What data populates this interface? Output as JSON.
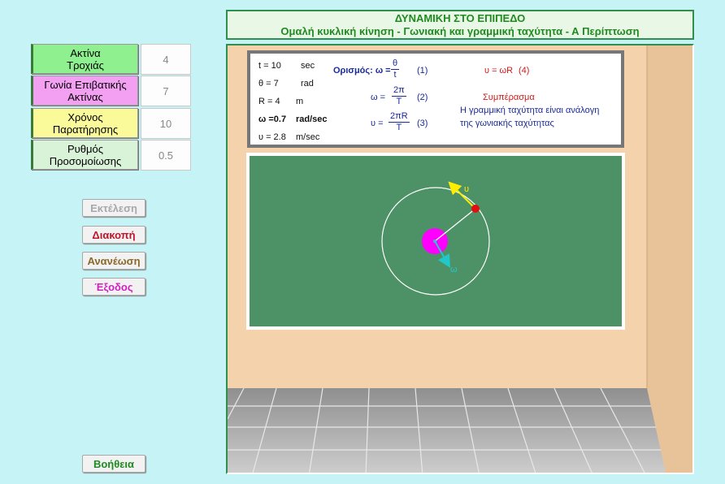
{
  "title": {
    "line1": "ΔΥΝΑΜΙΚΗ ΣΤΟ ΕΠΙΠΕΔΟ",
    "line2": "Ομαλή κυκλική κίνηση  - Γωνιακή και γραμμική ταχύτητα - Α Περίπτωση"
  },
  "params": [
    {
      "label1": "Ακτίνα",
      "label2": "Τροχιάς",
      "value": "4",
      "color": "#8ef08e"
    },
    {
      "label1": "Γωνία Επιβατικής",
      "label2": "Ακτίνας",
      "value": "7",
      "color": "#f3a0f3"
    },
    {
      "label1": "Χρόνος",
      "label2": "Παρατήρησης",
      "value": "10",
      "color": "#fafa9a"
    },
    {
      "label1": "Ρυθμός",
      "label2": "Προσομοίωσης",
      "value": "0.5",
      "color": "#d9f3d9"
    }
  ],
  "buttons": {
    "run": {
      "label": "Εκτέλεση",
      "color": "#a8a8a8"
    },
    "stop": {
      "label": "Διακοπή",
      "color": "#c0152a"
    },
    "reset": {
      "label": "Ανανέωση",
      "color": "#8a6a2a"
    },
    "exit": {
      "label": "Έξοδος",
      "color": "#d020c0"
    },
    "help": {
      "label": "Βοήθεια",
      "color": "#1f8a1f"
    }
  },
  "board": {
    "vars": [
      {
        "name": "t = 10",
        "unit": "sec"
      },
      {
        "name": "θ = 7",
        "unit": "rad"
      },
      {
        "name": "R = 4",
        "unit": "m"
      },
      {
        "name": "ω =0.7",
        "unit": "rad/sec"
      },
      {
        "name": "υ = 2.8",
        "unit": "m/sec"
      }
    ],
    "def_label": "Ορισμός: ω =",
    "eq1": {
      "num": "θ",
      "den": "t",
      "tag": "(1)"
    },
    "eq2": {
      "lhs": "ω =",
      "num": "2π",
      "den": "T",
      "tag": "(2)"
    },
    "eq3": {
      "lhs": "υ =",
      "num": "2πR",
      "den": "T",
      "tag": "(3)"
    },
    "eq4": {
      "text": "υ = ωR",
      "tag": "(4)"
    },
    "conclusion_title": "Συμπέρασμα",
    "conclusion_line1": "Η γραμμική ταχύτητα είναι ανάλογη",
    "conclusion_line2": "της γωνιακής ταχύτητας"
  },
  "sim": {
    "velocity_label": "υ",
    "omega_label": "ω"
  },
  "colors": {
    "background": "#c6f4f6",
    "wall": "#f4d2ac",
    "wall_side": "#e8c39a",
    "board_green": "#4d9166",
    "floor": "#a9a9a9"
  }
}
